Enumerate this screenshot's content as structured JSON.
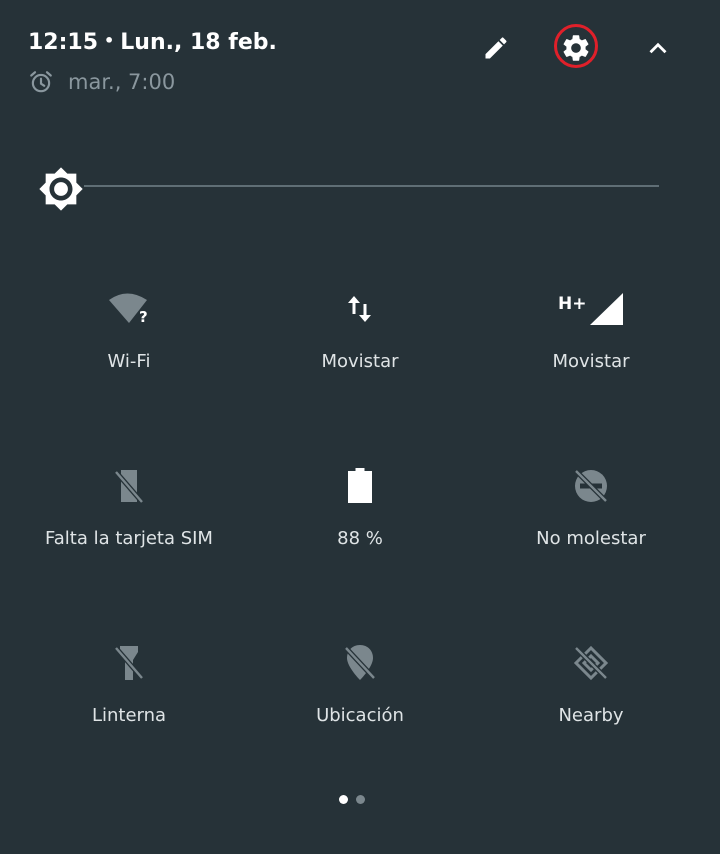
{
  "header": {
    "time": "12:15",
    "separator": "•",
    "date": "Lun., 18 feb.",
    "alarm_text": "mar., 7:00",
    "edit_icon": "pencil-icon",
    "settings_icon": "gear-icon",
    "collapse_icon": "chevron-up-icon",
    "highlight_color": "#e0202a"
  },
  "brightness": {
    "icon": "brightness-icon"
  },
  "tiles": [
    {
      "label": "Wi-Fi",
      "icon": "wifi-unknown-icon"
    },
    {
      "label": "Movistar",
      "icon": "data-arrows-icon"
    },
    {
      "label": "Movistar",
      "icon": "cell-signal-icon",
      "network_type": "H+"
    },
    {
      "label": "Falta la tarjeta SIM",
      "icon": "sim-missing-icon"
    },
    {
      "label": "88 %",
      "icon": "battery-icon"
    },
    {
      "label": "No molestar",
      "icon": "do-not-disturb-off-icon"
    },
    {
      "label": "Linterna",
      "icon": "flashlight-off-icon"
    },
    {
      "label": "Ubicación",
      "icon": "location-off-icon"
    },
    {
      "label": "Nearby",
      "icon": "nearby-off-icon"
    }
  ],
  "pager": {
    "pages": 2,
    "current": 1,
    "active_color": "#ffffff",
    "inactive_color": "#7b878d"
  },
  "colors": {
    "background": "#263238",
    "icon_disabled": "#7b878d",
    "label": "#dfe4e6"
  }
}
